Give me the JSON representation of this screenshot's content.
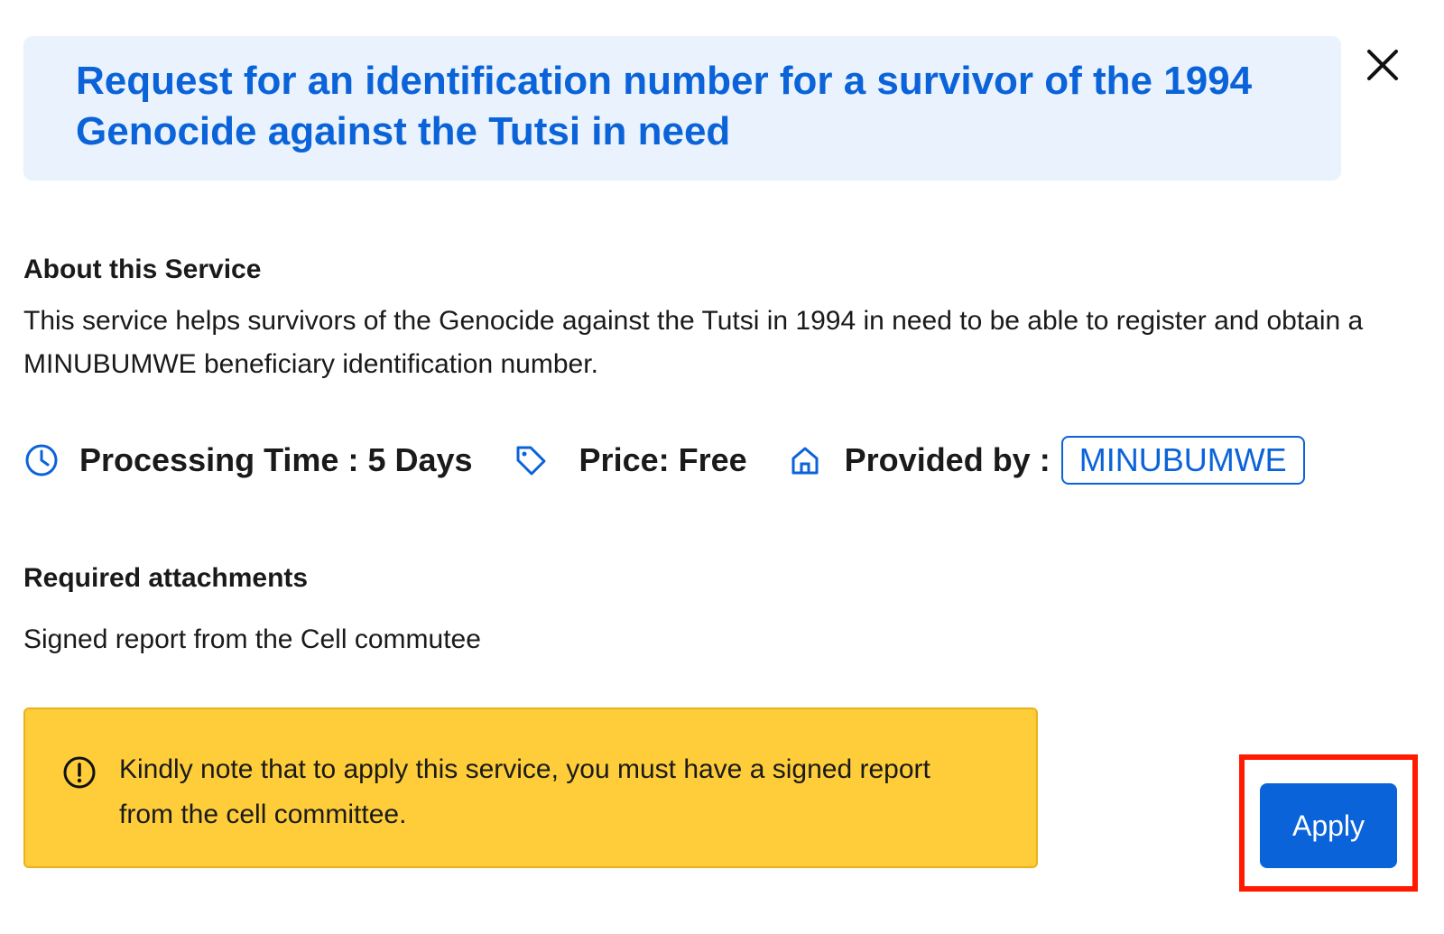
{
  "header": {
    "title": "Request for an identification number for a survivor of the 1994 Genocide against the Tutsi in need",
    "close_icon": "close-icon"
  },
  "about": {
    "heading": "About this Service",
    "text": "This service helps survivors of the Genocide against the Tutsi in 1994 in need to be able to register and obtain a MINUBUMWE beneficiary identification number."
  },
  "meta": {
    "processing_time": "Processing Time : 5 Days",
    "price": "Price: Free",
    "provided_by_label": "Provided by :",
    "provider": "MINUBUMWE",
    "icons": [
      "clock-icon",
      "tag-icon",
      "home-icon"
    ]
  },
  "attachments": {
    "heading": "Required attachments",
    "items": [
      "Signed report from the Cell commutee"
    ]
  },
  "notice": {
    "icon": "info-circle-icon",
    "text": "Kindly note that to apply this service, you must have a signed report from the cell committee."
  },
  "actions": {
    "apply_label": "Apply"
  },
  "colors": {
    "accent": "#0a63d8",
    "title_bg": "#eaf2fd",
    "notice_bg": "#fecd39",
    "highlight": "#ff1a00"
  }
}
